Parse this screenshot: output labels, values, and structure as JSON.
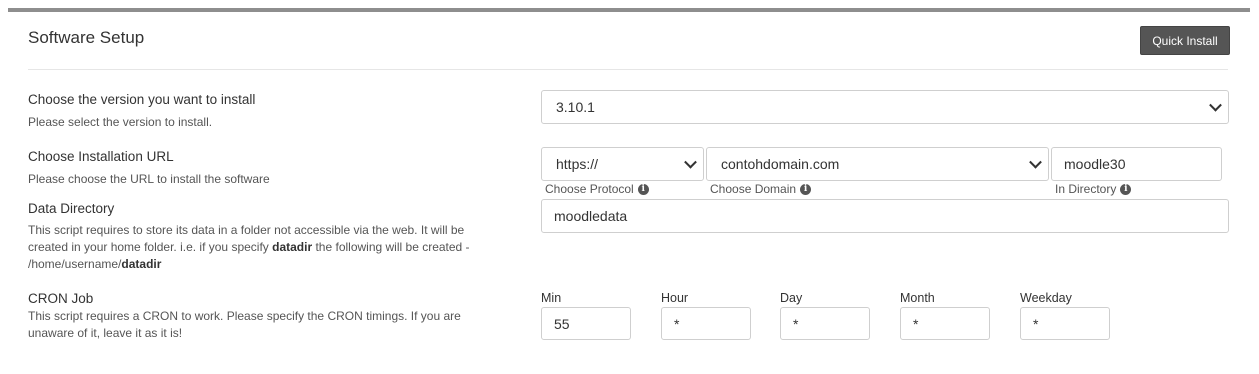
{
  "header": {
    "title": "Software Setup",
    "quick_install_label": "Quick Install"
  },
  "version": {
    "label": "Choose the version you want to install",
    "description": "Please select the version to install.",
    "selected": "3.10.1"
  },
  "install_url": {
    "label": "Choose Installation URL",
    "description": "Please choose the URL to install the software",
    "protocol": {
      "selected": "https://",
      "caption": "Choose Protocol",
      "icon": "info-icon"
    },
    "domain": {
      "selected": "contohdomain.com",
      "caption": "Choose Domain",
      "icon": "info-icon"
    },
    "directory": {
      "value": "moodle30",
      "caption": "In Directory",
      "icon": "info-icon"
    }
  },
  "data_directory": {
    "label": "Data Directory",
    "desc_part1": "This script requires to store its data in a folder not accessible via the web. It will be created in your home folder. i.e. if you specify ",
    "desc_bold1": "datadir",
    "desc_part2": " the following will be created - /home/username/",
    "desc_bold2": "datadir",
    "value": "moodledata"
  },
  "cron": {
    "label": "CRON Job",
    "description": "This script requires a CRON to work. Please specify the CRON timings. If you are unaware of it, leave it as it is!",
    "fields": [
      {
        "label": "Min",
        "value": "55"
      },
      {
        "label": "Hour",
        "value": "*"
      },
      {
        "label": "Day",
        "value": "*"
      },
      {
        "label": "Month",
        "value": "*"
      },
      {
        "label": "Weekday",
        "value": "*"
      }
    ]
  }
}
